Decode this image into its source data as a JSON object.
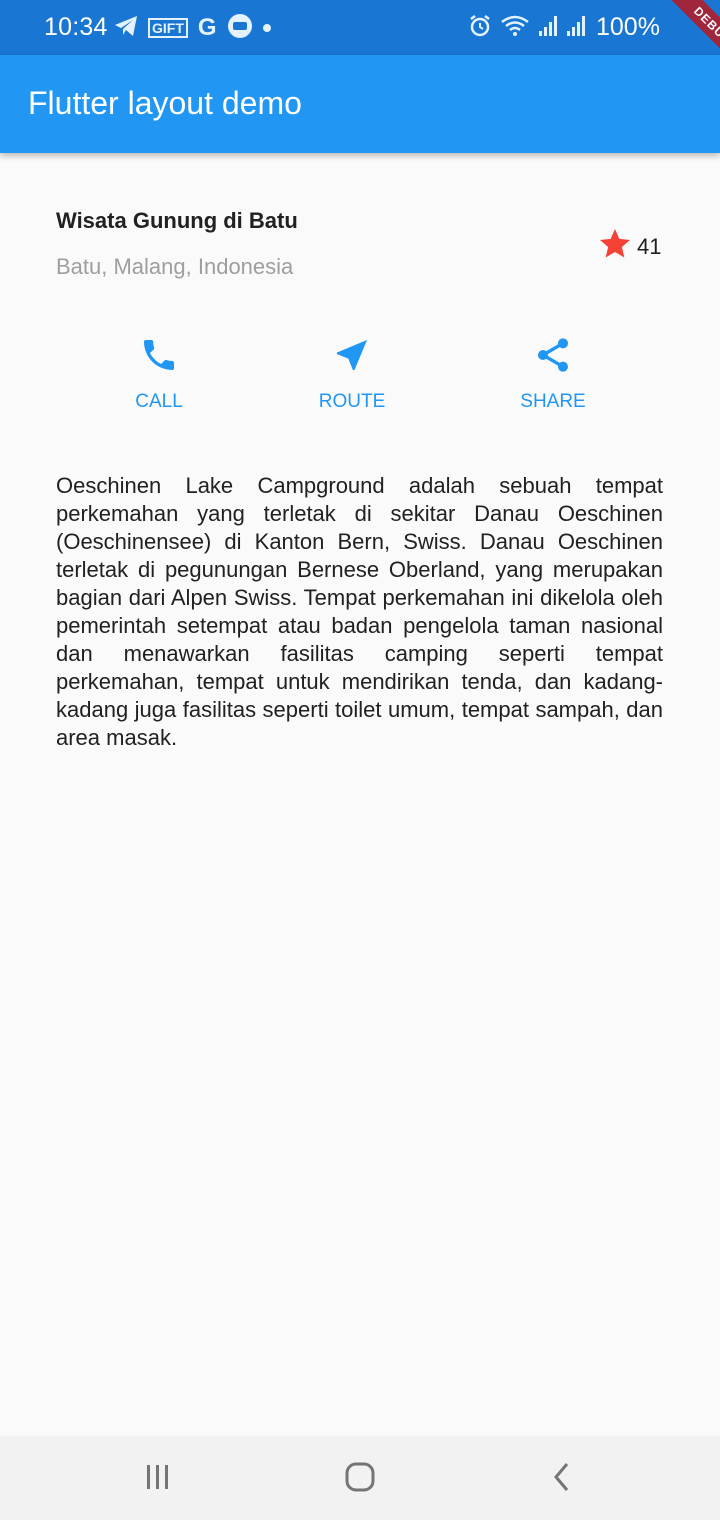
{
  "status_bar": {
    "time": "10:34",
    "battery": "100%",
    "gift_label": "GIFT",
    "g_label": "G",
    "left_icons": [
      "telegram-icon",
      "gift-icon",
      "g-icon",
      "message-icon",
      "dot-icon"
    ],
    "right_icons": [
      "alarm-icon",
      "wifi-icon",
      "signal-icon",
      "signal-icon",
      "battery-icon"
    ]
  },
  "debug_banner": "DEBUG",
  "app_bar": {
    "title": "Flutter layout demo"
  },
  "title_section": {
    "name": "Wisata Gunung di Batu",
    "location": "Batu, Malang, Indonesia",
    "rating_count": "41",
    "star_icon": "star-icon"
  },
  "buttons": [
    {
      "label": "CALL",
      "icon": "phone-icon"
    },
    {
      "label": "ROUTE",
      "icon": "navigation-icon"
    },
    {
      "label": "SHARE",
      "icon": "share-icon"
    }
  ],
  "description": "Oeschinen Lake Campground adalah sebuah tempat perkemahan yang terletak di sekitar Danau Oeschinen (Oeschinensee) di Kanton Bern, Swiss. Danau Oeschinen terletak di pegunungan Bernese Oberland, yang merupakan bagian dari Alpen Swiss. Tempat perkemahan ini dikelola oleh pemerintah setempat atau badan pengelola taman nasional dan menawarkan fasilitas camping seperti tempat perkemahan, tempat untuk mendirikan tenda, dan kadang-kadang juga fasilitas seperti toilet umum, tempat sampah, dan area masak.",
  "nav_bar": {
    "buttons": [
      "recents-icon",
      "home-icon",
      "back-icon"
    ]
  },
  "colors": {
    "primary": "#2196f3",
    "status": "#1976d2",
    "star": "#f44336",
    "subtitle": "#9e9e9e",
    "background": "#fafafa"
  }
}
